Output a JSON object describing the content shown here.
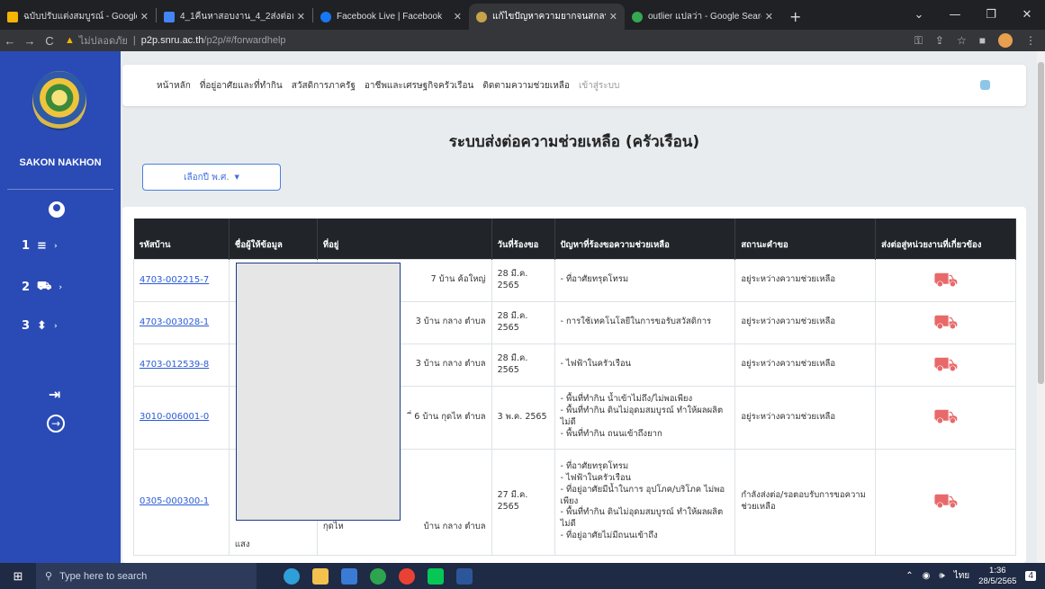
{
  "browser": {
    "tabs": [
      {
        "title": "ฉบับปรับแต่งสมบูรณ์ - Google Drive",
        "color": "#f4b400",
        "active": false
      },
      {
        "title": "4_1คืนหาสอบงาน_4_2ส่งต่อและยื่นเ",
        "color": "#4285f4",
        "active": false
      },
      {
        "title": "Facebook Live | Facebook",
        "color": "#1877f2",
        "active": false
      },
      {
        "title": "แก้ไขปัญหาความยากจนสกลนคร",
        "color": "#9aa0a6",
        "active": true
      },
      {
        "title": "outlier แปลว่า - Google Search",
        "color": "#34a853",
        "active": false
      }
    ],
    "url": {
      "warning": "▲",
      "not_secure": "ไม่ปลอดภัย",
      "host": "p2p.snru.ac.th",
      "path": "/p2p/#/forwardhelp"
    }
  },
  "sidebar": {
    "brand": "SAKON NAKHON",
    "items": [
      {
        "num": "1",
        "icon": "≡",
        "caret": "›"
      },
      {
        "num": "2",
        "icon": "⛟",
        "caret": "›"
      },
      {
        "num": "3",
        "icon": "⬍",
        "caret": "›"
      }
    ],
    "exit_icon": "⇥",
    "circle_icon": "→"
  },
  "topnav": {
    "links": [
      "หน้าหลัก",
      "ที่อยู่อาศัยและที่ทำกิน",
      "สวัสดิการภาครัฐ",
      "อาชีพและเศรษฐกิจครัวเรือน",
      "ติดตามความช่วยเหลือ"
    ],
    "login": "เข้าสู่ระบบ"
  },
  "page": {
    "title": "ระบบส่งต่อความช่วยเหลือ (ครัวเรือน)",
    "year_button": "เลือกปี พ.ศ.",
    "year_caret": "▼"
  },
  "table": {
    "headers": [
      "รหัสบ้าน",
      "ชื่อผู้ให้ข้อมูล",
      "ที่อยู่",
      "วันที่ร้องขอ",
      "ปัญหาที่ร้องขอความช่วยเหลือ",
      "สถานะคำขอ",
      "ส่งต่อสู่หน่วยงานที่เกี่ยวข้อง"
    ],
    "rows": [
      {
        "id": "4703-002215-7",
        "address": "7 บ้าน ค้อใหญ่",
        "date": "28 มี.ค. 2565",
        "problems": [
          "- ที่อาศัยทรุดโทรม"
        ],
        "status": "อยู่ระหว่างความช่วยเหลือ"
      },
      {
        "id": "4703-003028-1",
        "address": "3 บ้าน กลาง ตำบล",
        "date": "28 มี.ค. 2565",
        "problems": [
          "- การใช้เทคโนโลยีในการขอรับสวัสดิการ"
        ],
        "status": "อยู่ระหว่างความช่วยเหลือ"
      },
      {
        "id": "4703-012539-8",
        "address": "3 บ้าน กลาง ตำบล",
        "date": "28 มี.ค. 2565",
        "problems": [
          "- ไฟฟ้าในครัวเรือน"
        ],
        "status": "อยู่ระหว่างความช่วยเหลือ"
      },
      {
        "id": "3010-006001-0",
        "address": "ี่ 6 บ้าน กุดไห ตำบล",
        "date": "3 พ.ค. 2565",
        "problems": [
          "- พื้นที่ทำกิน น้ำเข้าไม่ถึง/ไม่พอเพียง",
          "- พื้นที่ทำกิน ดินไม่อุดมสมบูรณ์ ทำให้ผลผลิตไม่ดี",
          "- พื้นที่ทำกิน ถนนเข้าถึงยาก"
        ],
        "status": "อยู่ระหว่างความช่วยเหลือ"
      },
      {
        "id": "0305-000300-1",
        "address": "บ้าน กลาง ตำบล",
        "date": "27 มี.ค. 2565",
        "problems": [
          "- ที่อาศัยทรุดโทรม",
          "- ไฟฟ้าในครัวเรือน",
          "- ที่อยู่อาศัยมีน้ำในการ อุปโภค/บริโภค ไม่พอเพียง",
          "- พื้นที่ทำกิน ดินไม่อุดมสมบูรณ์ ทำให้ผลผลิตไม่ดี",
          "- ที่อยู่อาศัยไม่มีถนนเข้าถึง"
        ],
        "status": "กำลังส่งต่อ/รอตอบรับการขอความช่วยเหลือ",
        "name_fragment": "แสง",
        "addr_fragment": "กุดไห"
      }
    ],
    "action_icon": "⛟"
  },
  "taskbar": {
    "search_placeholder": "Type here to search",
    "time": "1:36",
    "date": "28/5/2565",
    "lang": "ไทย",
    "notif_count": "4"
  }
}
